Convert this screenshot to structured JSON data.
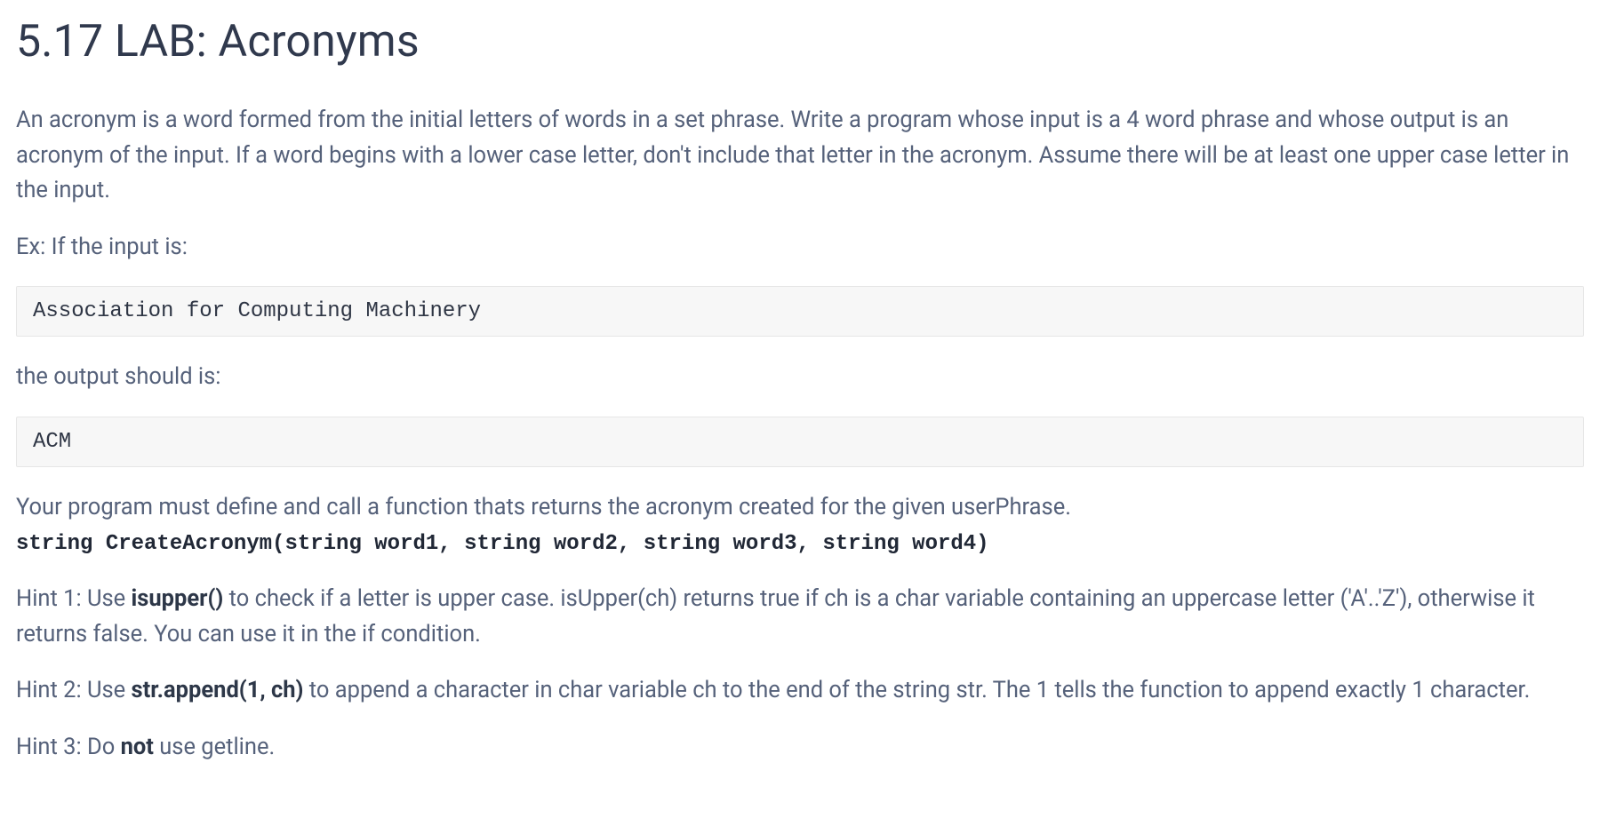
{
  "title": "5.17 LAB: Acronyms",
  "intro": "An acronym is a word formed from the initial letters of words in a set phrase. Write a program whose input is a 4 word phrase and whose output is an acronym of the input. If a word begins with a lower case letter, don't include that letter in the acronym. Assume there will be at least one upper case letter in the input.",
  "example_label": "Ex: If the input is:",
  "example_input": "Association for Computing Machinery",
  "output_label": "the output should is:",
  "example_output": "ACM",
  "func_req_line": "Your program must define and call a function thats returns the acronym created for the given userPhrase.",
  "func_signature": "string CreateAcronym(string word1, string word2, string word3, string word4)",
  "hint1": {
    "prefix": "Hint 1: Use ",
    "bold": "isupper()",
    "suffix": " to check if a letter is upper case. isUpper(ch) returns true if ch is a char variable containing an uppercase letter ('A'..'Z'), otherwise it returns false. You can use it in the if condition."
  },
  "hint2": {
    "prefix": "Hint 2: Use ",
    "bold": "str.append(1, ch)",
    "suffix": " to append a character in char variable ch to the end of the string str. The 1 tells the function to append exactly 1 character."
  },
  "hint3": {
    "prefix": "Hint 3: Do ",
    "bold": "not",
    "suffix": " use getline."
  }
}
